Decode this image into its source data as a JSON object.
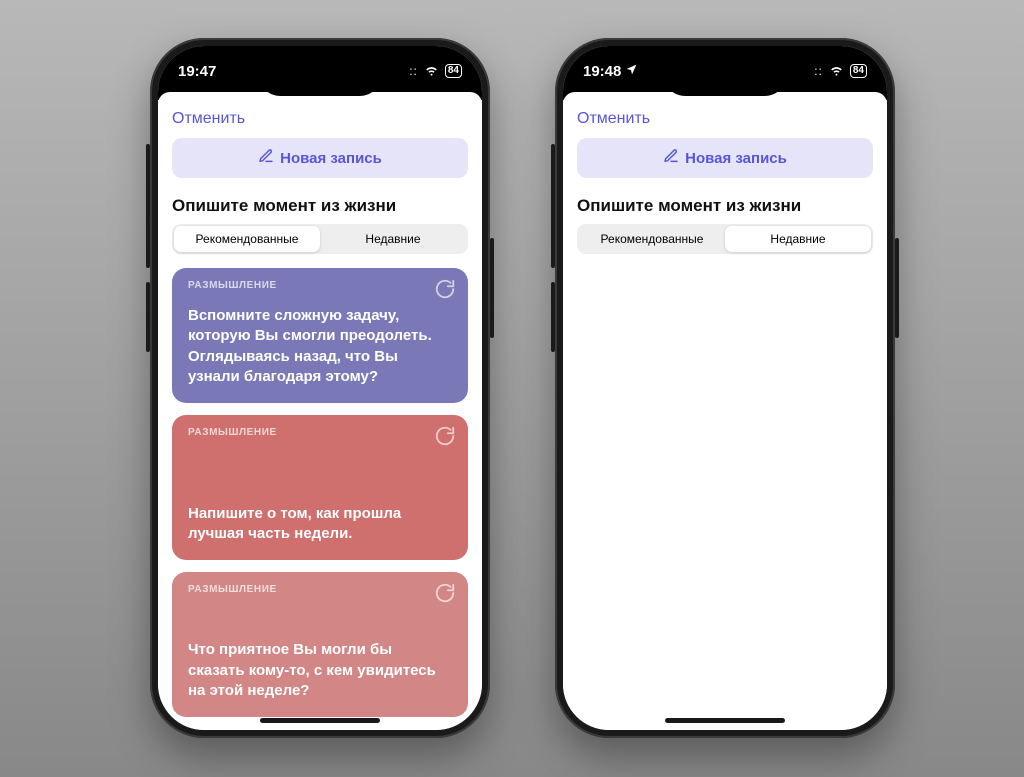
{
  "statusbar": {
    "time_left": "19:47",
    "time_right": "19:48",
    "battery": "84",
    "has_location_right": true
  },
  "modal": {
    "cancel": "Отменить",
    "new_entry": "Новая запись",
    "section_title": "Опишите момент из жизни",
    "tabs": {
      "recommended": "Рекомендованные",
      "recent": "Недавние"
    }
  },
  "cards": [
    {
      "category": "РАЗМЫШЛЕНИЕ",
      "text": "Вспомните сложную задачу, которую Вы смогли преодолеть. Оглядываясь назад, что Вы узнали благодаря этому?",
      "color": "purple"
    },
    {
      "category": "РАЗМЫШЛЕНИЕ",
      "text": "Напишите о том, как прошла лучшая часть недели.",
      "color": "red"
    },
    {
      "category": "РАЗМЫШЛЕНИЕ",
      "text": "Что приятное Вы могли бы сказать кому-то, с кем увидитесь на этой неделе?",
      "color": "pink"
    }
  ],
  "left_active_tab": "recommended",
  "right_active_tab": "recent"
}
